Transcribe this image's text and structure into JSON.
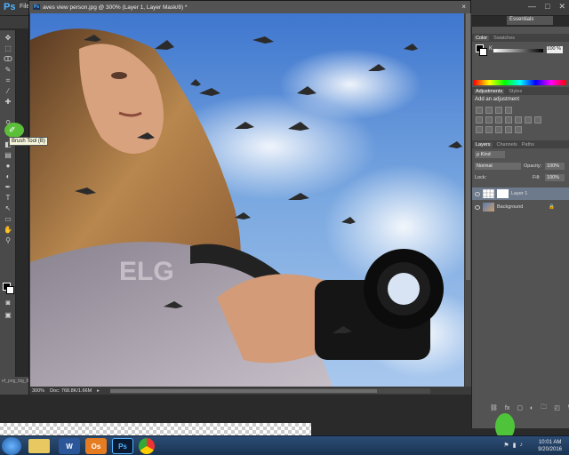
{
  "app": {
    "logo": "Ps",
    "menu_first": "File",
    "window_controls": [
      "—",
      "□",
      "✕"
    ],
    "workspace": "Essentials"
  },
  "document": {
    "tab_title": "aves view person.jpg @ 300% (Layer 1, Layer Mask/8) *",
    "ps_badge": "Ps",
    "close": "×",
    "zoom": "300%",
    "doc_size": "Doc: 768.8K/1.66M"
  },
  "tooltip": {
    "text": "Brush Tool (B)"
  },
  "left_panel": {
    "label": "ef_png_big_8"
  },
  "color_panel": {
    "tabs": [
      "Color",
      "Swatches"
    ],
    "channel_label": "K",
    "channel_value": "100 %"
  },
  "adjustments_panel": {
    "tabs": [
      "Adjustments",
      "Styles"
    ],
    "title": "Add an adjustment"
  },
  "layers_panel": {
    "tabs": [
      "Layers",
      "Channels",
      "Paths"
    ],
    "kind": "ρ Kind",
    "blend_mode": "Normal",
    "opacity_label": "Opacity:",
    "opacity_value": "100%",
    "lock_label": "Lock:",
    "fill_label": "Fill:",
    "fill_value": "100%",
    "layers": [
      {
        "name": "Layer 1",
        "selected": true
      },
      {
        "name": "Background",
        "selected": false
      }
    ],
    "footer_icons": [
      "fx",
      "◐",
      "▢",
      "◰",
      "🗀",
      "🗑"
    ]
  },
  "taskbar": {
    "apps": [
      "W",
      "Os",
      "Ps",
      "⬤"
    ],
    "time": "10:01 AM",
    "date": "9/20/2016"
  },
  "colors": {
    "ui_dark": "#535353",
    "selection": "#6d7a8c",
    "highlight_green": "#4fc43a",
    "sky_blue": "#5b8fd6"
  }
}
